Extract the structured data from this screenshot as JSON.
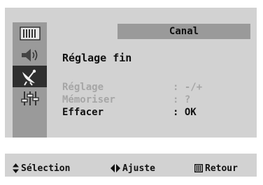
{
  "header": {
    "title": "Canal"
  },
  "screen": {
    "heading": "Réglage fin"
  },
  "menu": {
    "items": [
      {
        "label": "Réglage",
        "value": ": -/+",
        "enabled": false
      },
      {
        "label": "Mémoriser",
        "value": ":  ?",
        "enabled": false
      },
      {
        "label": "Effacer",
        "value": ": OK",
        "enabled": true
      }
    ]
  },
  "sidebar": {
    "icons": [
      "picture-icon",
      "speaker-icon",
      "antenna-icon",
      "equalizer-icon"
    ],
    "active_index": 2
  },
  "footer": {
    "select_label": "Sélection",
    "adjust_label": "Ajuste",
    "return_label": "Retour"
  },
  "colors": {
    "panel": "#d2d2d2",
    "sidebar": "#9a9a9a",
    "active_slot": "#2f2f2f",
    "disabled_text": "#a6a6a6",
    "text": "#111111"
  }
}
